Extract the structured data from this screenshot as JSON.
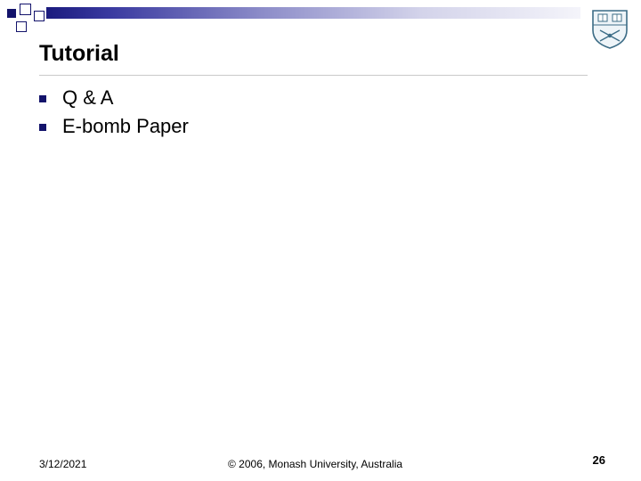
{
  "slide": {
    "title": "Tutorial",
    "bullets": [
      {
        "text": "Q & A"
      },
      {
        "text": "E-bomb Paper"
      }
    ]
  },
  "footer": {
    "date": "3/12/2021",
    "copyright": "© 2006,  Monash University,  Australia",
    "page_number": "26"
  },
  "icons": {
    "logo": "monash-university-crest-icon",
    "bullet": "square-bullet-icon"
  },
  "colors": {
    "accent": "#13136b",
    "title_rule": "#c9c9c9"
  }
}
